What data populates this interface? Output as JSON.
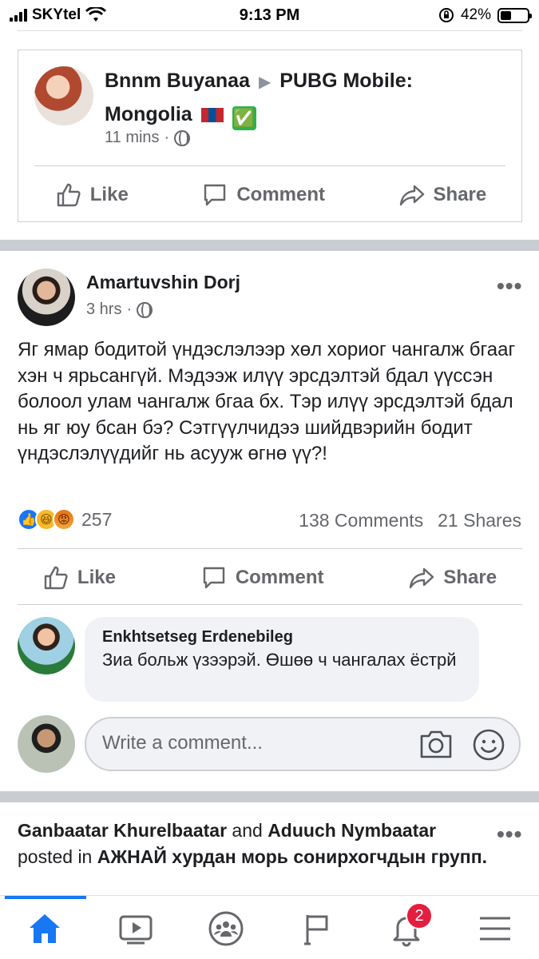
{
  "status_bar": {
    "carrier": "SKYtel",
    "time": "9:13 PM",
    "battery": "42%",
    "battery_level": 0.42
  },
  "shared_post": {
    "author": "Bnnm Buyanaa",
    "group": "PUBG Mobile: Mongolia",
    "time": "11 mins",
    "emoji": "✅"
  },
  "actions": {
    "like": "Like",
    "comment": "Comment",
    "share": "Share"
  },
  "post": {
    "author": "Amartuvshin Dorj",
    "time": "3 hrs",
    "text": "Яг ямар бодитой үндэслэлээр хөл хориог чангалж бгааг хэн ч ярьсангүй. Мэдээж илүү эрсдэлтэй бдал үүссэн болоол улам чангалж бгаа бх. Тэр илүү эрсдэлтэй бдал нь яг юу бсан бэ? Сэтгүүлчидээ шийдвэрийн бодит үндэслэлүүдийг нь асууж өгнө үү?!",
    "reaction_count": "257",
    "comments": "138 Comments",
    "shares": "21 Shares",
    "more": "•••"
  },
  "comment": {
    "author": "Enkhtsetseg Erdenebileg",
    "text": "Зиа больж үзээрэй. Өшөө ч чангалах ёстрй"
  },
  "write_comment": {
    "placeholder": "Write a comment..."
  },
  "next_post": {
    "author1": "Ganbaatar Khurelbaatar",
    "and": "and",
    "author2": "Aduuch Nymbaatar",
    "posted_in": "posted in",
    "group": "АЖНАЙ хурдан морь сонирхогчдын групп",
    "more": "•••"
  },
  "nav": {
    "notifications_badge": "2",
    "accent": "#1877f2"
  }
}
